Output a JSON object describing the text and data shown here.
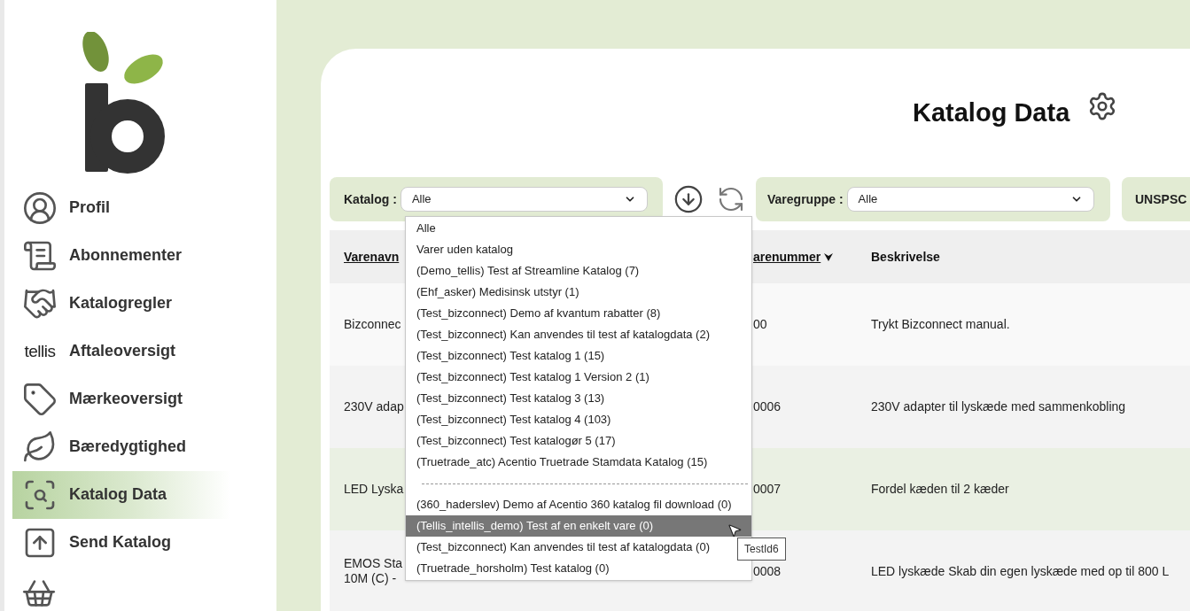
{
  "sidebar": {
    "items": [
      {
        "label": "Profil",
        "kind": "icon",
        "selected": false
      },
      {
        "label": "Abonnementer",
        "kind": "icon",
        "selected": false
      },
      {
        "label": "Katalogregler",
        "kind": "icon",
        "selected": false
      },
      {
        "label": "Aftaleoversigt",
        "kind": "text-logo",
        "logo_text": "tellis",
        "selected": false
      },
      {
        "label": "Mærkeoversigt",
        "kind": "icon",
        "selected": false
      },
      {
        "label": "Bæredygtighed",
        "kind": "icon",
        "selected": false
      },
      {
        "label": "Katalog Data",
        "kind": "icon",
        "selected": true
      },
      {
        "label": "Send Katalog",
        "kind": "icon",
        "selected": false
      }
    ]
  },
  "page_title": "Katalog Data",
  "filters": [
    {
      "label": "Katalog :",
      "value": "Alle"
    },
    {
      "label": "Varegruppe :",
      "value": "Alle"
    },
    {
      "label": "UNSPSC"
    }
  ],
  "table": {
    "columns": [
      {
        "label": "Varenavn",
        "sortable": true,
        "sorted": false
      },
      {
        "label": "arenummer",
        "sortable": true,
        "sorted": true
      },
      {
        "label": "Beskrivelse",
        "sortable": false,
        "sorted": false
      }
    ],
    "rows": [
      {
        "highlighted": false,
        "cells": [
          [
            "Bizconnec"
          ],
          [
            "00"
          ],
          [
            "Trykt Bizconnect manual."
          ]
        ]
      },
      {
        "highlighted": false,
        "cells": [
          [
            "230V adap"
          ],
          [
            "0006"
          ],
          [
            "230V adapter til lyskæde med sammenkobling"
          ]
        ]
      },
      {
        "highlighted": true,
        "cells": [
          [
            "LED Lyska"
          ],
          [
            "0007"
          ],
          [
            "Fordel kæden til 2 kæder"
          ]
        ]
      },
      {
        "highlighted": false,
        "cells": [
          [
            "EMOS Sta",
            "10M (C) -"
          ],
          [
            "0008"
          ],
          [
            "LED lyskæde Skab din egen lyskæde med op til 800 L"
          ]
        ]
      }
    ]
  },
  "dropdown": {
    "options": [
      {
        "kind": "option",
        "label": "Alle",
        "selected": false
      },
      {
        "kind": "option",
        "label": "Varer uden katalog",
        "selected": false
      },
      {
        "kind": "option",
        "label": "(Demo_tellis) Test af Streamline Katalog (7)",
        "selected": false
      },
      {
        "kind": "option",
        "label": "(Ehf_asker) Medisinsk utstyr (1)",
        "selected": false
      },
      {
        "kind": "option",
        "label": "(Test_bizconnect) Demo af kvantum rabatter (8)",
        "selected": false
      },
      {
        "kind": "option",
        "label": "(Test_bizconnect) Kan anvendes til test af katalogdata (2)",
        "selected": false
      },
      {
        "kind": "option",
        "label": "(Test_bizconnect) Test katalog 1 (15)",
        "selected": false
      },
      {
        "kind": "option",
        "label": "(Test_bizconnect) Test katalog 1 Version 2 (1)",
        "selected": false
      },
      {
        "kind": "option",
        "label": "(Test_bizconnect) Test katalog 3 (13)",
        "selected": false
      },
      {
        "kind": "option",
        "label": "(Test_bizconnect) Test katalog 4 (103)",
        "selected": false
      },
      {
        "kind": "option",
        "label": "(Test_bizconnect) Test katalogør 5 (17)",
        "selected": false
      },
      {
        "kind": "option",
        "label": "(Truetrade_atc) Acentio Truetrade Stamdata Katalog (15)",
        "selected": false
      },
      {
        "kind": "separator"
      },
      {
        "kind": "option",
        "label": "(360_haderslev) Demo af Acentio 360 katalog fil download (0)",
        "selected": false
      },
      {
        "kind": "option",
        "label": "(Tellis_intellis_demo) Test af en enkelt vare (0)",
        "selected": true
      },
      {
        "kind": "option",
        "label": "(Test_bizconnect) Kan anvendes til test af katalogdata (0)",
        "selected": false
      },
      {
        "kind": "option",
        "label": "(Truetrade_horsholm) Test katalog (0)",
        "selected": false
      }
    ]
  },
  "tooltip": "TestId6"
}
